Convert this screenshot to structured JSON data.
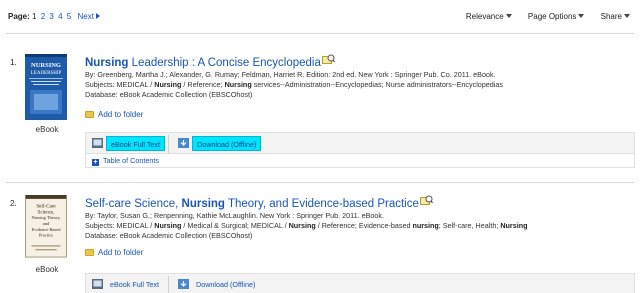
{
  "pager": {
    "label": "Page:",
    "pages": [
      "1",
      "2",
      "3",
      "4",
      "5"
    ],
    "next": "Next"
  },
  "menus": {
    "relevance": "Relevance",
    "page_options": "Page Options",
    "share": "Share"
  },
  "results": [
    {
      "number": "1.",
      "title_hl": "Nursing",
      "title_rest": " Leadership : A Concise Encyclopedia",
      "cover_text": [
        "NURSING",
        "LEADERSHIP"
      ],
      "type_label": "eBook",
      "byline": "By: Greenberg, Martha J.; Alexander, G. Rumay; Feldman, Harriet R. Edition: 2nd ed. New York : Springer Pub. Co. 2011. eBook.",
      "subjects_a": "Subjects: MEDICAL / ",
      "subjects_b": "Nursing",
      "subjects_c": " / Reference; ",
      "subjects_d": "Nursing",
      "subjects_e": " services--Administration--Encyclopedias; Nurse administrators--Encyclopedias",
      "database": "Database: eBook Academic Collection (EBSCOhost)",
      "add_folder": "Add to folder",
      "full_text": "eBook Full Text",
      "download": "Download (Offline)",
      "toc": "Table of Contents"
    },
    {
      "number": "2.",
      "title_a": "Self-care Science, ",
      "title_hl": "Nursing",
      "title_rest": " Theory, and Evidence-based Practice",
      "cover_text": [
        "Self-Care",
        "Science,",
        "Nursing Theory,",
        "and",
        "Evidence-Based",
        "Practice"
      ],
      "type_label": "eBook",
      "byline": "By: Taylor, Susan G.; Renpenning, Kathie McLaughlin. New York : Springer Pub. 2011. eBook.",
      "subjects_a": "Subjects: MEDICAL / ",
      "subjects_b": "Nursing",
      "subjects_c": " / Medical & Surgical; MEDICAL / ",
      "subjects_d": "Nursing",
      "subjects_e": " / Reference; Evidence-based ",
      "subjects_f": "nursing",
      "subjects_g": "; Self-care, Health; ",
      "subjects_h": "Nursing",
      "database": "Database: eBook Academic Collection (EBSCOhost)",
      "add_folder": "Add to folder",
      "full_text": "eBook Full Text",
      "download": "Download (Offline)"
    }
  ],
  "colors": {
    "link": "#1a55b5",
    "highlight": "#00e5ff"
  }
}
